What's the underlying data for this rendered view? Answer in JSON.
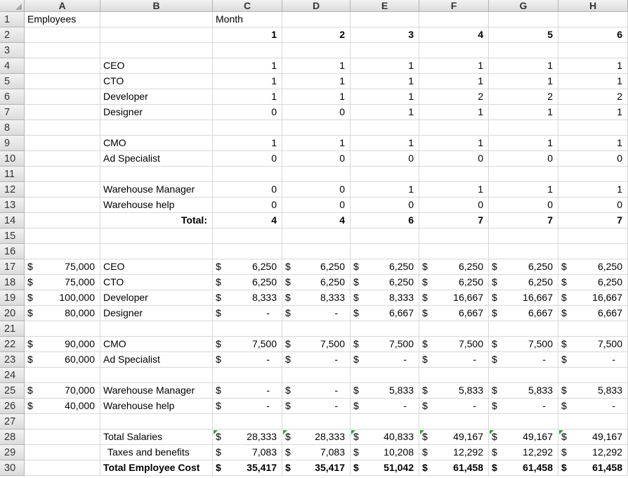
{
  "columns": [
    "A",
    "B",
    "C",
    "D",
    "E",
    "F",
    "G",
    "H"
  ],
  "rows": [
    "1",
    "2",
    "3",
    "4",
    "5",
    "6",
    "7",
    "8",
    "9",
    "10",
    "11",
    "12",
    "13",
    "14",
    "15",
    "16",
    "17",
    "18",
    "19",
    "20",
    "21",
    "22",
    "23",
    "24",
    "25",
    "26",
    "27",
    "28",
    "29",
    "30"
  ],
  "cells": [
    {
      "r": 1,
      "c": "A",
      "v": "Employees"
    },
    {
      "r": 1,
      "c": "C",
      "v": "Month"
    },
    {
      "r": 2,
      "c": "C",
      "v": "1",
      "align": "r",
      "bold": true
    },
    {
      "r": 2,
      "c": "D",
      "v": "2",
      "align": "r",
      "bold": true
    },
    {
      "r": 2,
      "c": "E",
      "v": "3",
      "align": "r",
      "bold": true
    },
    {
      "r": 2,
      "c": "F",
      "v": "4",
      "align": "r",
      "bold": true
    },
    {
      "r": 2,
      "c": "G",
      "v": "5",
      "align": "r",
      "bold": true
    },
    {
      "r": 2,
      "c": "H",
      "v": "6",
      "align": "r",
      "bold": true
    },
    {
      "r": 4,
      "c": "B",
      "v": "CEO"
    },
    {
      "r": 4,
      "c": "C",
      "v": "1",
      "align": "r"
    },
    {
      "r": 4,
      "c": "D",
      "v": "1",
      "align": "r"
    },
    {
      "r": 4,
      "c": "E",
      "v": "1",
      "align": "r"
    },
    {
      "r": 4,
      "c": "F",
      "v": "1",
      "align": "r"
    },
    {
      "r": 4,
      "c": "G",
      "v": "1",
      "align": "r"
    },
    {
      "r": 4,
      "c": "H",
      "v": "1",
      "align": "r"
    },
    {
      "r": 5,
      "c": "B",
      "v": "CTO"
    },
    {
      "r": 5,
      "c": "C",
      "v": "1",
      "align": "r"
    },
    {
      "r": 5,
      "c": "D",
      "v": "1",
      "align": "r"
    },
    {
      "r": 5,
      "c": "E",
      "v": "1",
      "align": "r"
    },
    {
      "r": 5,
      "c": "F",
      "v": "1",
      "align": "r"
    },
    {
      "r": 5,
      "c": "G",
      "v": "1",
      "align": "r"
    },
    {
      "r": 5,
      "c": "H",
      "v": "1",
      "align": "r"
    },
    {
      "r": 6,
      "c": "B",
      "v": "Developer"
    },
    {
      "r": 6,
      "c": "C",
      "v": "1",
      "align": "r"
    },
    {
      "r": 6,
      "c": "D",
      "v": "1",
      "align": "r"
    },
    {
      "r": 6,
      "c": "E",
      "v": "1",
      "align": "r"
    },
    {
      "r": 6,
      "c": "F",
      "v": "2",
      "align": "r"
    },
    {
      "r": 6,
      "c": "G",
      "v": "2",
      "align": "r"
    },
    {
      "r": 6,
      "c": "H",
      "v": "2",
      "align": "r"
    },
    {
      "r": 7,
      "c": "B",
      "v": "Designer"
    },
    {
      "r": 7,
      "c": "C",
      "v": "0",
      "align": "r"
    },
    {
      "r": 7,
      "c": "D",
      "v": "0",
      "align": "r"
    },
    {
      "r": 7,
      "c": "E",
      "v": "1",
      "align": "r"
    },
    {
      "r": 7,
      "c": "F",
      "v": "1",
      "align": "r"
    },
    {
      "r": 7,
      "c": "G",
      "v": "1",
      "align": "r"
    },
    {
      "r": 7,
      "c": "H",
      "v": "1",
      "align": "r"
    },
    {
      "r": 9,
      "c": "B",
      "v": "CMO"
    },
    {
      "r": 9,
      "c": "C",
      "v": "1",
      "align": "r"
    },
    {
      "r": 9,
      "c": "D",
      "v": "1",
      "align": "r"
    },
    {
      "r": 9,
      "c": "E",
      "v": "1",
      "align": "r"
    },
    {
      "r": 9,
      "c": "F",
      "v": "1",
      "align": "r"
    },
    {
      "r": 9,
      "c": "G",
      "v": "1",
      "align": "r"
    },
    {
      "r": 9,
      "c": "H",
      "v": "1",
      "align": "r"
    },
    {
      "r": 10,
      "c": "B",
      "v": "Ad Specialist"
    },
    {
      "r": 10,
      "c": "C",
      "v": "0",
      "align": "r"
    },
    {
      "r": 10,
      "c": "D",
      "v": "0",
      "align": "r"
    },
    {
      "r": 10,
      "c": "E",
      "v": "0",
      "align": "r"
    },
    {
      "r": 10,
      "c": "F",
      "v": "0",
      "align": "r"
    },
    {
      "r": 10,
      "c": "G",
      "v": "0",
      "align": "r"
    },
    {
      "r": 10,
      "c": "H",
      "v": "0",
      "align": "r"
    },
    {
      "r": 12,
      "c": "B",
      "v": "Warehouse Manager"
    },
    {
      "r": 12,
      "c": "C",
      "v": "0",
      "align": "r"
    },
    {
      "r": 12,
      "c": "D",
      "v": "0",
      "align": "r"
    },
    {
      "r": 12,
      "c": "E",
      "v": "1",
      "align": "r"
    },
    {
      "r": 12,
      "c": "F",
      "v": "1",
      "align": "r"
    },
    {
      "r": 12,
      "c": "G",
      "v": "1",
      "align": "r"
    },
    {
      "r": 12,
      "c": "H",
      "v": "1",
      "align": "r"
    },
    {
      "r": 13,
      "c": "B",
      "v": "Warehouse help"
    },
    {
      "r": 13,
      "c": "C",
      "v": "0",
      "align": "r"
    },
    {
      "r": 13,
      "c": "D",
      "v": "0",
      "align": "r"
    },
    {
      "r": 13,
      "c": "E",
      "v": "0",
      "align": "r"
    },
    {
      "r": 13,
      "c": "F",
      "v": "0",
      "align": "r"
    },
    {
      "r": 13,
      "c": "G",
      "v": "0",
      "align": "r"
    },
    {
      "r": 13,
      "c": "H",
      "v": "0",
      "align": "r"
    },
    {
      "r": 14,
      "c": "B",
      "v": "Total:",
      "align": "r",
      "bold": true
    },
    {
      "r": 14,
      "c": "C",
      "v": "4",
      "align": "r",
      "bold": true
    },
    {
      "r": 14,
      "c": "D",
      "v": "4",
      "align": "r",
      "bold": true
    },
    {
      "r": 14,
      "c": "E",
      "v": "6",
      "align": "r",
      "bold": true
    },
    {
      "r": 14,
      "c": "F",
      "v": "7",
      "align": "r",
      "bold": true
    },
    {
      "r": 14,
      "c": "G",
      "v": "7",
      "align": "r",
      "bold": true
    },
    {
      "r": 14,
      "c": "H",
      "v": "7",
      "align": "r",
      "bold": true
    },
    {
      "r": 17,
      "c": "A",
      "cur": "$",
      "v": "75,000"
    },
    {
      "r": 17,
      "c": "B",
      "v": "CEO"
    },
    {
      "r": 17,
      "c": "C",
      "cur": "$",
      "v": "6,250"
    },
    {
      "r": 17,
      "c": "D",
      "cur": "$",
      "v": "6,250"
    },
    {
      "r": 17,
      "c": "E",
      "cur": "$",
      "v": "6,250"
    },
    {
      "r": 17,
      "c": "F",
      "cur": "$",
      "v": "6,250"
    },
    {
      "r": 17,
      "c": "G",
      "cur": "$",
      "v": "6,250"
    },
    {
      "r": 17,
      "c": "H",
      "cur": "$",
      "v": "6,250"
    },
    {
      "r": 18,
      "c": "A",
      "cur": "$",
      "v": "75,000"
    },
    {
      "r": 18,
      "c": "B",
      "v": "CTO"
    },
    {
      "r": 18,
      "c": "C",
      "cur": "$",
      "v": "6,250"
    },
    {
      "r": 18,
      "c": "D",
      "cur": "$",
      "v": "6,250"
    },
    {
      "r": 18,
      "c": "E",
      "cur": "$",
      "v": "6,250"
    },
    {
      "r": 18,
      "c": "F",
      "cur": "$",
      "v": "6,250"
    },
    {
      "r": 18,
      "c": "G",
      "cur": "$",
      "v": "6,250"
    },
    {
      "r": 18,
      "c": "H",
      "cur": "$",
      "v": "6,250"
    },
    {
      "r": 19,
      "c": "A",
      "cur": "$",
      "v": "100,000"
    },
    {
      "r": 19,
      "c": "B",
      "v": "Developer"
    },
    {
      "r": 19,
      "c": "C",
      "cur": "$",
      "v": "8,333"
    },
    {
      "r": 19,
      "c": "D",
      "cur": "$",
      "v": "8,333"
    },
    {
      "r": 19,
      "c": "E",
      "cur": "$",
      "v": "8,333"
    },
    {
      "r": 19,
      "c": "F",
      "cur": "$",
      "v": "16,667"
    },
    {
      "r": 19,
      "c": "G",
      "cur": "$",
      "v": "16,667"
    },
    {
      "r": 19,
      "c": "H",
      "cur": "$",
      "v": "16,667"
    },
    {
      "r": 20,
      "c": "A",
      "cur": "$",
      "v": "80,000"
    },
    {
      "r": 20,
      "c": "B",
      "v": "Designer"
    },
    {
      "r": 20,
      "c": "C",
      "cur": "$",
      "v": "-",
      "dash": true
    },
    {
      "r": 20,
      "c": "D",
      "cur": "$",
      "v": "-",
      "dash": true
    },
    {
      "r": 20,
      "c": "E",
      "cur": "$",
      "v": "6,667"
    },
    {
      "r": 20,
      "c": "F",
      "cur": "$",
      "v": "6,667"
    },
    {
      "r": 20,
      "c": "G",
      "cur": "$",
      "v": "6,667"
    },
    {
      "r": 20,
      "c": "H",
      "cur": "$",
      "v": "6,667"
    },
    {
      "r": 22,
      "c": "A",
      "cur": "$",
      "v": "90,000"
    },
    {
      "r": 22,
      "c": "B",
      "v": "CMO"
    },
    {
      "r": 22,
      "c": "C",
      "cur": "$",
      "v": "7,500"
    },
    {
      "r": 22,
      "c": "D",
      "cur": "$",
      "v": "7,500"
    },
    {
      "r": 22,
      "c": "E",
      "cur": "$",
      "v": "7,500"
    },
    {
      "r": 22,
      "c": "F",
      "cur": "$",
      "v": "7,500"
    },
    {
      "r": 22,
      "c": "G",
      "cur": "$",
      "v": "7,500"
    },
    {
      "r": 22,
      "c": "H",
      "cur": "$",
      "v": "7,500"
    },
    {
      "r": 23,
      "c": "A",
      "cur": "$",
      "v": "60,000"
    },
    {
      "r": 23,
      "c": "B",
      "v": "Ad Specialist"
    },
    {
      "r": 23,
      "c": "C",
      "cur": "$",
      "v": "-",
      "dash": true
    },
    {
      "r": 23,
      "c": "D",
      "cur": "$",
      "v": "-",
      "dash": true
    },
    {
      "r": 23,
      "c": "E",
      "cur": "$",
      "v": "-",
      "dash": true
    },
    {
      "r": 23,
      "c": "F",
      "cur": "$",
      "v": "-",
      "dash": true
    },
    {
      "r": 23,
      "c": "G",
      "cur": "$",
      "v": "-",
      "dash": true
    },
    {
      "r": 23,
      "c": "H",
      "cur": "$",
      "v": "-",
      "dash": true
    },
    {
      "r": 25,
      "c": "A",
      "cur": "$",
      "v": "70,000"
    },
    {
      "r": 25,
      "c": "B",
      "v": "Warehouse Manager"
    },
    {
      "r": 25,
      "c": "C",
      "cur": "$",
      "v": "-",
      "dash": true
    },
    {
      "r": 25,
      "c": "D",
      "cur": "$",
      "v": "-",
      "dash": true
    },
    {
      "r": 25,
      "c": "E",
      "cur": "$",
      "v": "5,833"
    },
    {
      "r": 25,
      "c": "F",
      "cur": "$",
      "v": "5,833"
    },
    {
      "r": 25,
      "c": "G",
      "cur": "$",
      "v": "5,833"
    },
    {
      "r": 25,
      "c": "H",
      "cur": "$",
      "v": "5,833"
    },
    {
      "r": 26,
      "c": "A",
      "cur": "$",
      "v": "40,000"
    },
    {
      "r": 26,
      "c": "B",
      "v": "Warehouse help"
    },
    {
      "r": 26,
      "c": "C",
      "cur": "$",
      "v": "-",
      "dash": true
    },
    {
      "r": 26,
      "c": "D",
      "cur": "$",
      "v": "-",
      "dash": true
    },
    {
      "r": 26,
      "c": "E",
      "cur": "$",
      "v": "-",
      "dash": true
    },
    {
      "r": 26,
      "c": "F",
      "cur": "$",
      "v": "-",
      "dash": true
    },
    {
      "r": 26,
      "c": "G",
      "cur": "$",
      "v": "-",
      "dash": true
    },
    {
      "r": 26,
      "c": "H",
      "cur": "$",
      "v": "-",
      "dash": true
    },
    {
      "r": 28,
      "c": "B",
      "v": "Total Salaries"
    },
    {
      "r": 28,
      "c": "C",
      "cur": "$",
      "v": "28,333",
      "flag": true
    },
    {
      "r": 28,
      "c": "D",
      "cur": "$",
      "v": "28,333",
      "flag": true
    },
    {
      "r": 28,
      "c": "E",
      "cur": "$",
      "v": "40,833",
      "flag": true
    },
    {
      "r": 28,
      "c": "F",
      "cur": "$",
      "v": "49,167",
      "flag": true
    },
    {
      "r": 28,
      "c": "G",
      "cur": "$",
      "v": "49,167",
      "flag": true
    },
    {
      "r": 28,
      "c": "H",
      "cur": "$",
      "v": "49,167",
      "flag": true
    },
    {
      "r": 29,
      "c": "B",
      "v": "Taxes and benefits",
      "indent": true
    },
    {
      "r": 29,
      "c": "C",
      "cur": "$",
      "v": "7,083"
    },
    {
      "r": 29,
      "c": "D",
      "cur": "$",
      "v": "7,083"
    },
    {
      "r": 29,
      "c": "E",
      "cur": "$",
      "v": "10,208"
    },
    {
      "r": 29,
      "c": "F",
      "cur": "$",
      "v": "12,292"
    },
    {
      "r": 29,
      "c": "G",
      "cur": "$",
      "v": "12,292"
    },
    {
      "r": 29,
      "c": "H",
      "cur": "$",
      "v": "12,292"
    },
    {
      "r": 30,
      "c": "B",
      "v": "Total Employee Cost",
      "bold": true
    },
    {
      "r": 30,
      "c": "C",
      "cur": "$",
      "v": "35,417",
      "bold": true
    },
    {
      "r": 30,
      "c": "D",
      "cur": "$",
      "v": "35,417",
      "bold": true
    },
    {
      "r": 30,
      "c": "E",
      "cur": "$",
      "v": "51,042",
      "bold": true
    },
    {
      "r": 30,
      "c": "F",
      "cur": "$",
      "v": "61,458",
      "bold": true
    },
    {
      "r": 30,
      "c": "G",
      "cur": "$",
      "v": "61,458",
      "bold": true
    },
    {
      "r": 30,
      "c": "H",
      "cur": "$",
      "v": "61,458",
      "bold": true
    }
  ]
}
